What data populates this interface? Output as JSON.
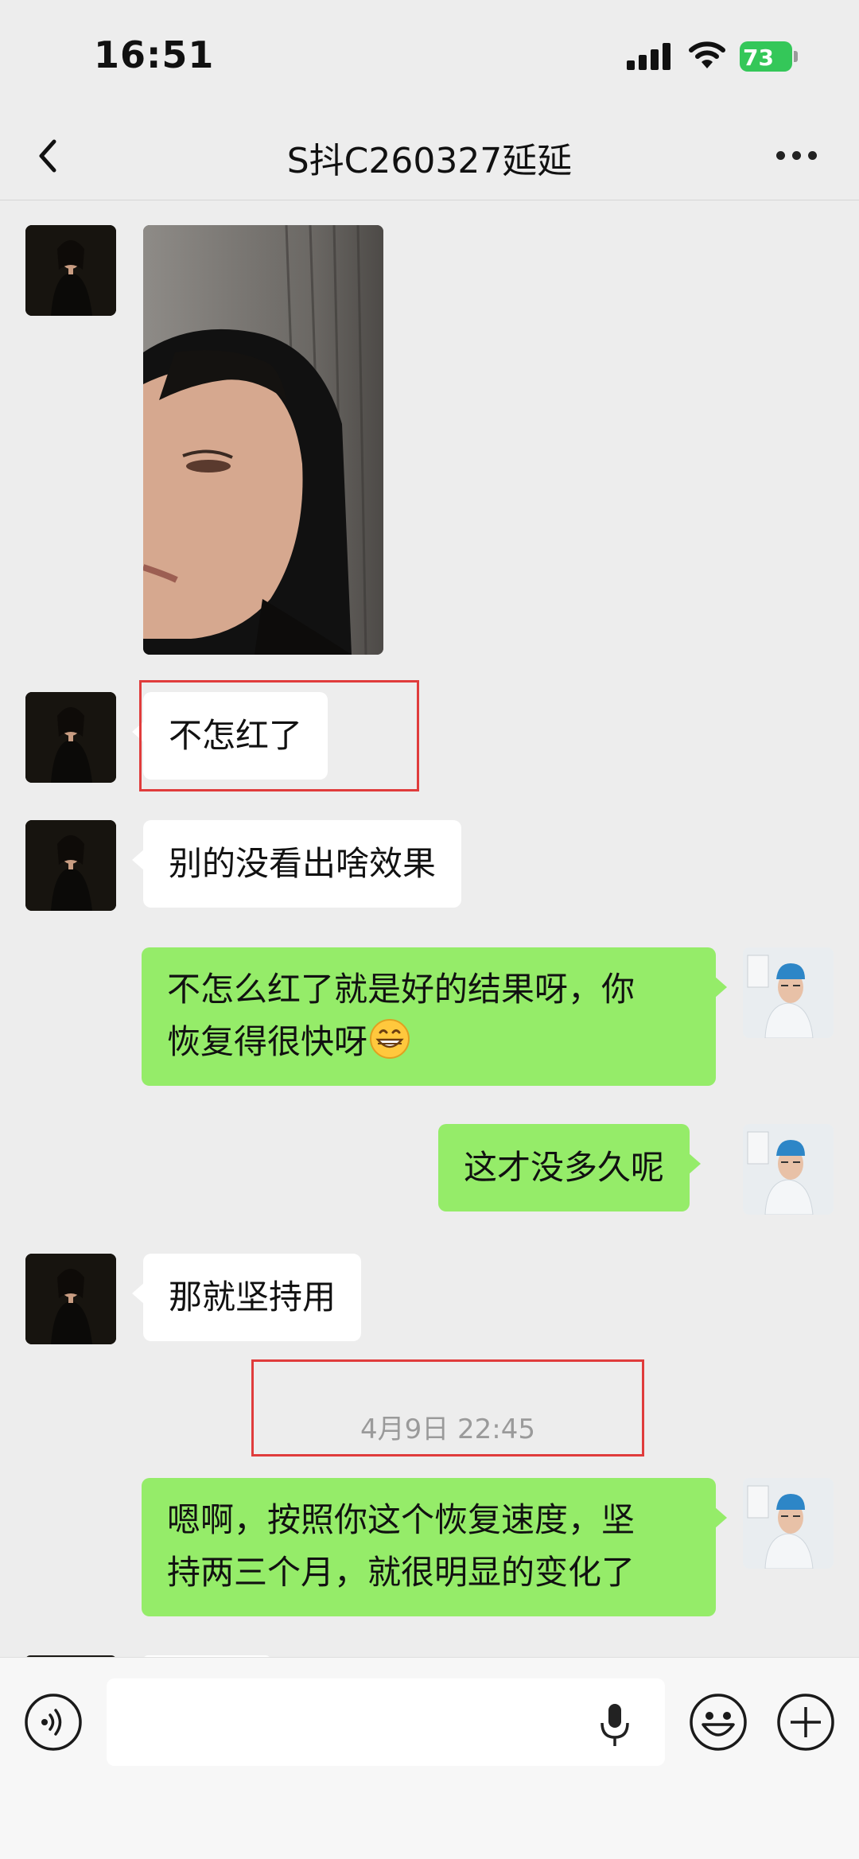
{
  "status_bar": {
    "time": "16:51",
    "battery": "73"
  },
  "header": {
    "title": "S抖C260327延延"
  },
  "messages": [
    {
      "side": "left",
      "type": "image"
    },
    {
      "side": "left",
      "text": "不怎红了"
    },
    {
      "side": "left",
      "text": "别的没看出啥效果"
    },
    {
      "side": "right",
      "lines": [
        "不怎么红了就是好的结果呀，你",
        "恢复得很快呀"
      ],
      "emoji": "grinning-face-emoji"
    },
    {
      "side": "right",
      "text": "这才没多久呢"
    },
    {
      "side": "left",
      "text": "那就坚持用"
    },
    {
      "side": "right",
      "lines": [
        "嗯啊，按照你这个恢复速度，坚",
        "持两三个月，就很明显的变化了"
      ]
    }
  ],
  "timestamp": "4月9日 22:45",
  "colors": {
    "self_bubble": "#95ec69",
    "other_bubble": "#ffffff",
    "background": "#ededed",
    "highlight": "#e03c3c",
    "battery": "#34c759"
  },
  "input_bar": {
    "value": "",
    "icons": [
      "voice-icon",
      "microphone-icon",
      "emoji-icon",
      "add-icon"
    ]
  }
}
